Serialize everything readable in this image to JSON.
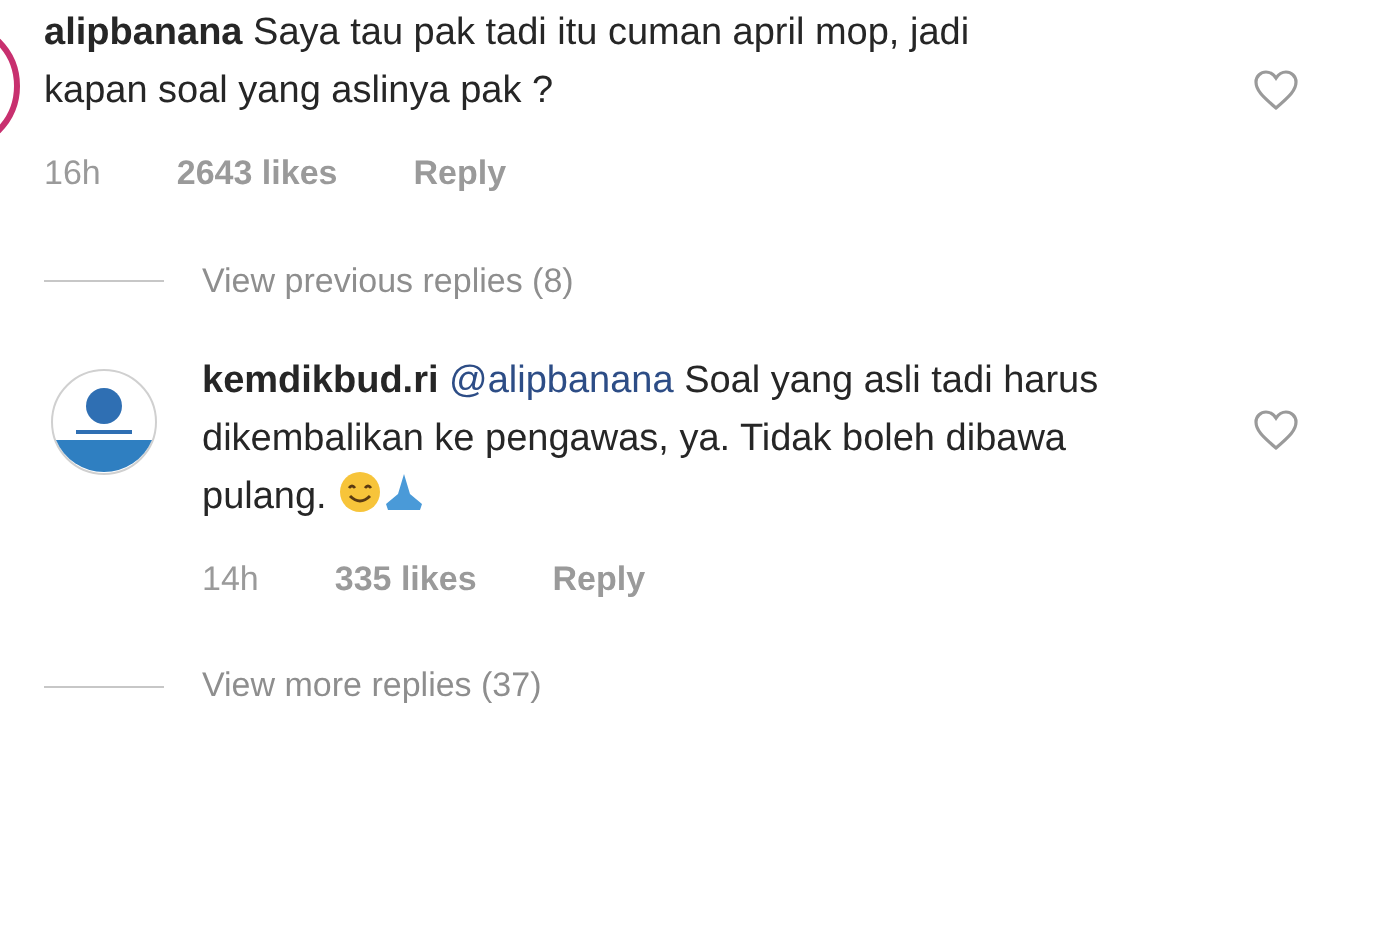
{
  "thread": [
    {
      "kind": "comment",
      "avatar": {
        "kind": "ring"
      },
      "username": "alipbanana",
      "text": "Saya tau pak tadi itu cuman april mop, jadi kapan soal yang aslinya pak ?",
      "time": "16h",
      "likes": "2643 likes",
      "reply": "Reply",
      "liked": false
    },
    {
      "kind": "view_replies",
      "label": "View previous replies (8)"
    },
    {
      "kind": "comment",
      "avatar": {
        "kind": "emblem"
      },
      "username": "kemdikbud.ri",
      "mention": "@alipbanana",
      "text": "Soal yang asli tadi harus dikembalikan ke pengawas, ya. Tidak boleh dibawa pulang.",
      "emoji": true,
      "time": "14h",
      "likes": "335 likes",
      "reply": "Reply",
      "liked": false
    },
    {
      "kind": "view_replies",
      "label": "View more replies (37)"
    }
  ]
}
